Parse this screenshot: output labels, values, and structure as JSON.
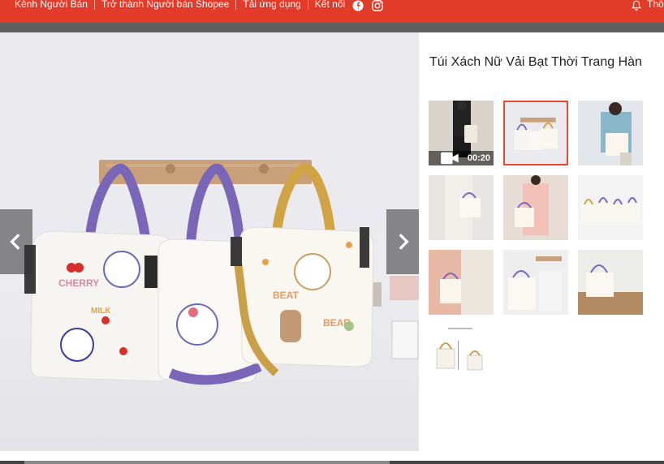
{
  "topbar": {
    "links": [
      "Kênh Người Bán",
      "Trở thành Người bán Shopee",
      "Tải ứng dụng",
      "Kết nối"
    ],
    "social_icons": [
      "facebook-icon",
      "instagram-icon"
    ],
    "notification_label": "Thô",
    "bg_color": "#e33b2a"
  },
  "product": {
    "title": "Túi Xách Nữ Vải Bạt Thời Trang Hàn",
    "video_duration": "00:20",
    "thumbnails": [
      {
        "name": "thumb-video",
        "selected": false
      },
      {
        "name": "thumb-2",
        "selected": true
      },
      {
        "name": "thumb-3",
        "selected": false
      },
      {
        "name": "thumb-4",
        "selected": false
      },
      {
        "name": "thumb-5",
        "selected": false
      },
      {
        "name": "thumb-6",
        "selected": false
      },
      {
        "name": "thumb-7",
        "selected": false
      },
      {
        "name": "thumb-8",
        "selected": false
      },
      {
        "name": "thumb-9",
        "selected": false
      },
      {
        "name": "thumb-10",
        "selected": false
      }
    ],
    "accent_color": "#e8492f"
  }
}
